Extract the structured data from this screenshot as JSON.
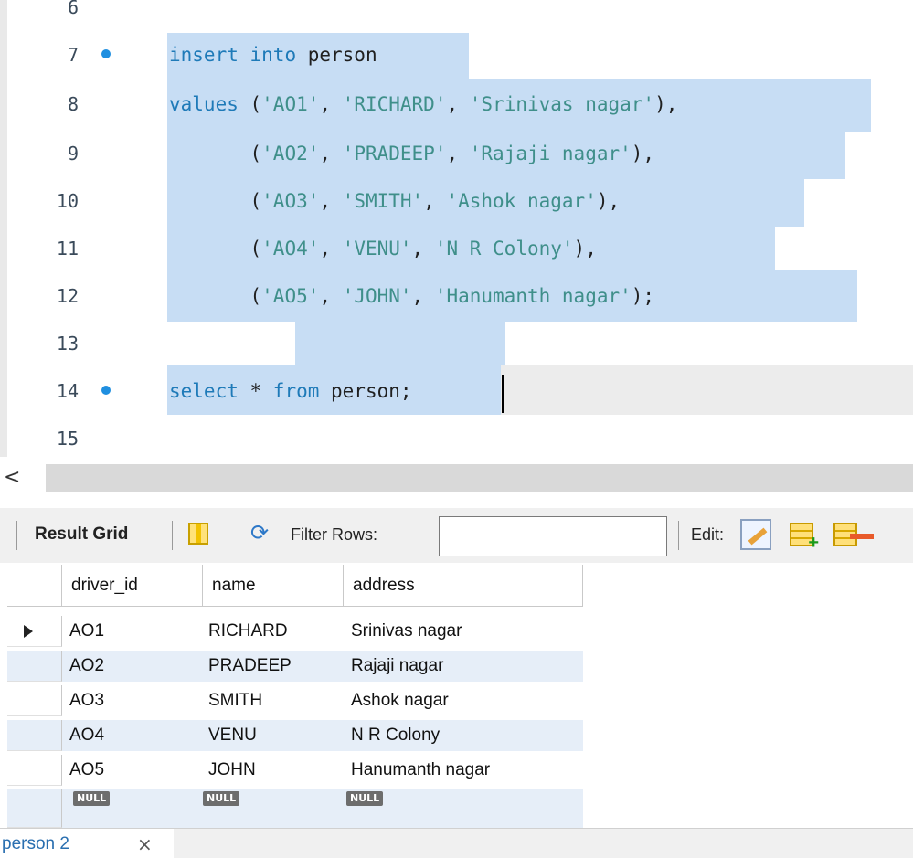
{
  "editor": {
    "lines": [
      {
        "num": "6",
        "dot": false,
        "tokens": []
      },
      {
        "num": "7",
        "dot": true,
        "tokens": [
          {
            "t": "insert",
            "k": "kw"
          },
          {
            "t": " ",
            "k": ""
          },
          {
            "t": "into",
            "k": "kw"
          },
          {
            "t": " person",
            "k": ""
          }
        ]
      },
      {
        "num": "8",
        "dot": false,
        "tokens": [
          {
            "t": "values",
            "k": "kw"
          },
          {
            "t": " (",
            "k": ""
          },
          {
            "t": "'AO1'",
            "k": "str"
          },
          {
            "t": ", ",
            "k": ""
          },
          {
            "t": "'RICHARD'",
            "k": "str"
          },
          {
            "t": ", ",
            "k": ""
          },
          {
            "t": "'Srinivas nagar'",
            "k": "str"
          },
          {
            "t": "),",
            "k": ""
          }
        ]
      },
      {
        "num": "9",
        "dot": false,
        "tokens": [
          {
            "t": "       (",
            "k": ""
          },
          {
            "t": "'AO2'",
            "k": "str"
          },
          {
            "t": ", ",
            "k": ""
          },
          {
            "t": "'PRADEEP'",
            "k": "str"
          },
          {
            "t": ", ",
            "k": ""
          },
          {
            "t": "'Rajaji nagar'",
            "k": "str"
          },
          {
            "t": "),",
            "k": ""
          }
        ]
      },
      {
        "num": "10",
        "dot": false,
        "tokens": [
          {
            "t": "       (",
            "k": ""
          },
          {
            "t": "'AO3'",
            "k": "str"
          },
          {
            "t": ", ",
            "k": ""
          },
          {
            "t": "'SMITH'",
            "k": "str"
          },
          {
            "t": ", ",
            "k": ""
          },
          {
            "t": "'Ashok nagar'",
            "k": "str"
          },
          {
            "t": "),",
            "k": ""
          }
        ]
      },
      {
        "num": "11",
        "dot": false,
        "tokens": [
          {
            "t": "       (",
            "k": ""
          },
          {
            "t": "'AO4'",
            "k": "str"
          },
          {
            "t": ", ",
            "k": ""
          },
          {
            "t": "'VENU'",
            "k": "str"
          },
          {
            "t": ", ",
            "k": ""
          },
          {
            "t": "'N R Colony'",
            "k": "str"
          },
          {
            "t": "),",
            "k": ""
          }
        ]
      },
      {
        "num": "12",
        "dot": false,
        "tokens": [
          {
            "t": "       (",
            "k": ""
          },
          {
            "t": "'AO5'",
            "k": "str"
          },
          {
            "t": ", ",
            "k": ""
          },
          {
            "t": "'JOHN'",
            "k": "str"
          },
          {
            "t": ", ",
            "k": ""
          },
          {
            "t": "'Hanumanth nagar'",
            "k": "str"
          },
          {
            "t": ");",
            "k": ""
          }
        ]
      },
      {
        "num": "13",
        "dot": false,
        "tokens": []
      },
      {
        "num": "14",
        "dot": true,
        "tokens": [
          {
            "t": "select",
            "k": "kw"
          },
          {
            "t": " * ",
            "k": ""
          },
          {
            "t": "from",
            "k": "kw"
          },
          {
            "t": " person;",
            "k": ""
          }
        ]
      },
      {
        "num": "15",
        "dot": false,
        "tokens": []
      }
    ]
  },
  "hscroll": {
    "left_arrow": "<"
  },
  "toolbar": {
    "result_grid_label": "Result Grid",
    "filter_label": "Filter Rows:",
    "filter_value": "",
    "edit_label": "Edit:"
  },
  "grid": {
    "columns": [
      "driver_id",
      "name",
      "address"
    ],
    "rows": [
      [
        "AO1",
        "RICHARD",
        "Srinivas nagar"
      ],
      [
        "AO2",
        "PRADEEP",
        "Rajaji nagar"
      ],
      [
        "AO3",
        "SMITH",
        "Ashok nagar"
      ],
      [
        "AO4",
        "VENU",
        "N R Colony"
      ],
      [
        "AO5",
        "JOHN",
        "Hanumanth nagar"
      ]
    ],
    "null_label": "NULL"
  },
  "tabbar": {
    "tab_label": "person 2",
    "close_glyph": "×"
  }
}
